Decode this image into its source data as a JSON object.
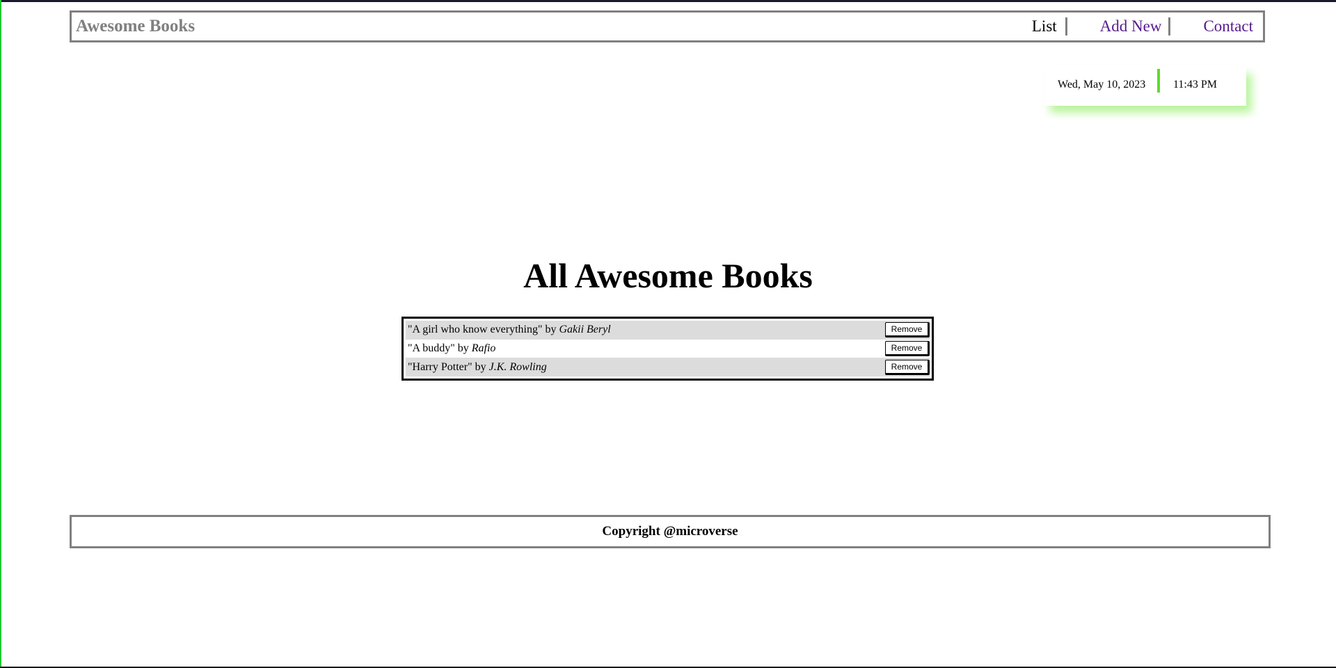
{
  "header": {
    "logo": "Awesome Books",
    "nav": {
      "list": "List",
      "add_new": "Add New",
      "contact": "Contact"
    }
  },
  "datetime": {
    "date": "Wed, May 10, 2023",
    "time": "11:43 PM"
  },
  "main": {
    "title": "All Awesome Books",
    "books": [
      {
        "title": "\"A girl who know everything\"",
        "by": " by ",
        "author": "Gakii Beryl",
        "remove_label": "Remove"
      },
      {
        "title": "\"A buddy\"",
        "by": " by ",
        "author": "Rafio",
        "remove_label": "Remove"
      },
      {
        "title": "\"Harry Potter\"",
        "by": " by ",
        "author": "J.K. Rowling",
        "remove_label": "Remove"
      }
    ]
  },
  "footer": {
    "text": "Copyright @microverse"
  },
  "colors": {
    "accent_green": "#5ddc2a",
    "shadow_green": "#b8f59c",
    "nav_link": "#551a8b",
    "border_gray": "#808080",
    "row_shade": "#dcdcdc"
  }
}
